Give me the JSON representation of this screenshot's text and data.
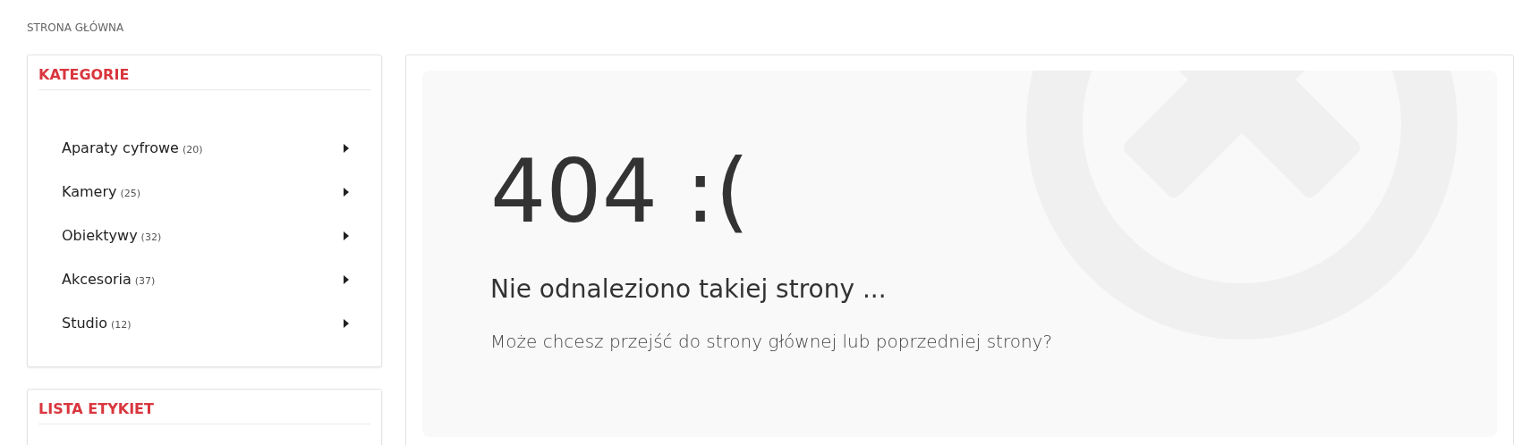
{
  "breadcrumb": "STRONA GŁÓWNA",
  "sidebar": [
    {
      "title": "KATEGORIE",
      "items": [
        {
          "label": "Aparaty cyfrowe",
          "count": "(20)"
        },
        {
          "label": "Kamery",
          "count": "(25)"
        },
        {
          "label": "Obiektywy",
          "count": "(32)"
        },
        {
          "label": "Akcesoria",
          "count": "(37)"
        },
        {
          "label": "Studio",
          "count": "(12)"
        }
      ]
    },
    {
      "title": "LISTA ETYKIET"
    }
  ],
  "error": {
    "code": "404 :(",
    "title": "Nie odnaleziono takiej strony ...",
    "message": "Może chcesz przejść do strony głównej lub poprzedniej strony?"
  }
}
